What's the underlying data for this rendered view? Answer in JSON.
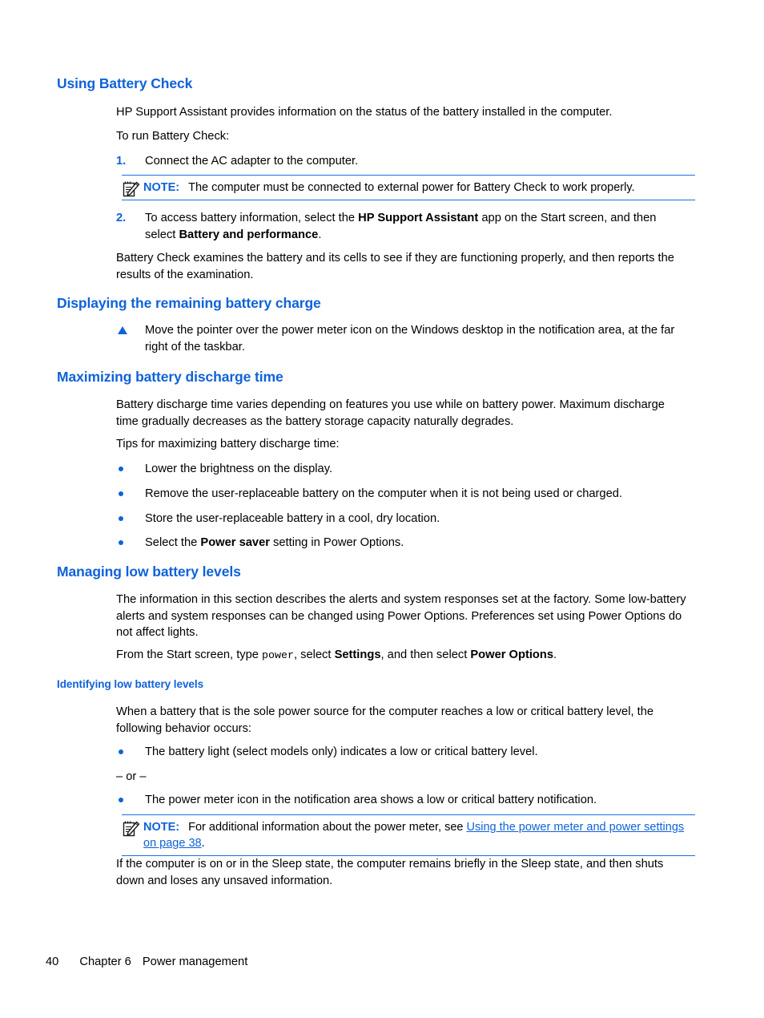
{
  "colors": {
    "heading_blue": "#0f62d8",
    "rule_blue": "#1a6fe0",
    "body_black": "#000000"
  },
  "sections": {
    "using_battery_check": {
      "heading": "Using Battery Check",
      "intro": "HP Support Assistant provides information on the status of the battery installed in the computer.",
      "lead_in": "To run Battery Check:",
      "step1_num": "1.",
      "step1_text": "Connect the AC adapter to the computer.",
      "note1_label": "NOTE:",
      "note1_text": "The computer must be connected to external power for Battery Check to work properly.",
      "step2_num": "2.",
      "step2_part1": "To access battery information, select the ",
      "step2_bold1": "HP Support Assistant",
      "step2_part2": " app on the Start screen, and then select ",
      "step2_bold2": "Battery and performance",
      "step2_part3": ".",
      "closing": "Battery Check examines the battery and its cells to see if they are functioning properly, and then reports the results of the examination."
    },
    "displaying_charge": {
      "heading": "Displaying the remaining battery charge",
      "bullet": "Move the pointer over the power meter icon on the Windows desktop in the notification area, at the far right of the taskbar."
    },
    "maximizing_discharge": {
      "heading": "Maximizing battery discharge time",
      "para": "Battery discharge time varies depending on features you use while on battery power. Maximum discharge time gradually decreases as the battery storage capacity naturally degrades.",
      "lead_in": "Tips for maximizing battery discharge time:",
      "tips": [
        "Lower the brightness on the display.",
        "Remove the user-replaceable battery on the computer when it is not being used or charged.",
        "Store the user-replaceable battery in a cool, dry location."
      ],
      "tip4_part1": "Select the ",
      "tip4_bold": "Power saver",
      "tip4_part2": " setting in Power Options."
    },
    "managing_low": {
      "heading": "Managing low battery levels",
      "para": "The information in this section describes the alerts and system responses set at the factory. Some low-battery alerts and system responses can be changed using Power Options. Preferences set using Power Options do not affect lights.",
      "start_part1": "From the Start screen, type ",
      "start_mono": "power",
      "start_part2": ", select ",
      "start_bold1": "Settings",
      "start_part3": ", and then select ",
      "start_bold2": "Power Options",
      "start_part4": "."
    },
    "identifying_low": {
      "heading": "Identifying low battery levels",
      "para": "When a battery that is the sole power source for the computer reaches a low or critical battery level, the following behavior occurs:",
      "bullet1": "The battery light (select models only) indicates a low or critical battery level.",
      "or_text": "– or –",
      "bullet2": "The power meter icon in the notification area shows a low or critical battery notification.",
      "note2_label": "NOTE:",
      "note2_text": "For additional information about the power meter, see ",
      "note2_link": "Using the power meter and power settings on page 38",
      "note2_text_end": ".",
      "final_para": "If the computer is on or in the Sleep state, the computer remains briefly in the Sleep state, and then shuts down and loses any unsaved information."
    }
  },
  "footer": {
    "page_number": "40",
    "chapter": "Chapter 6",
    "chapter_title": "Power management"
  }
}
